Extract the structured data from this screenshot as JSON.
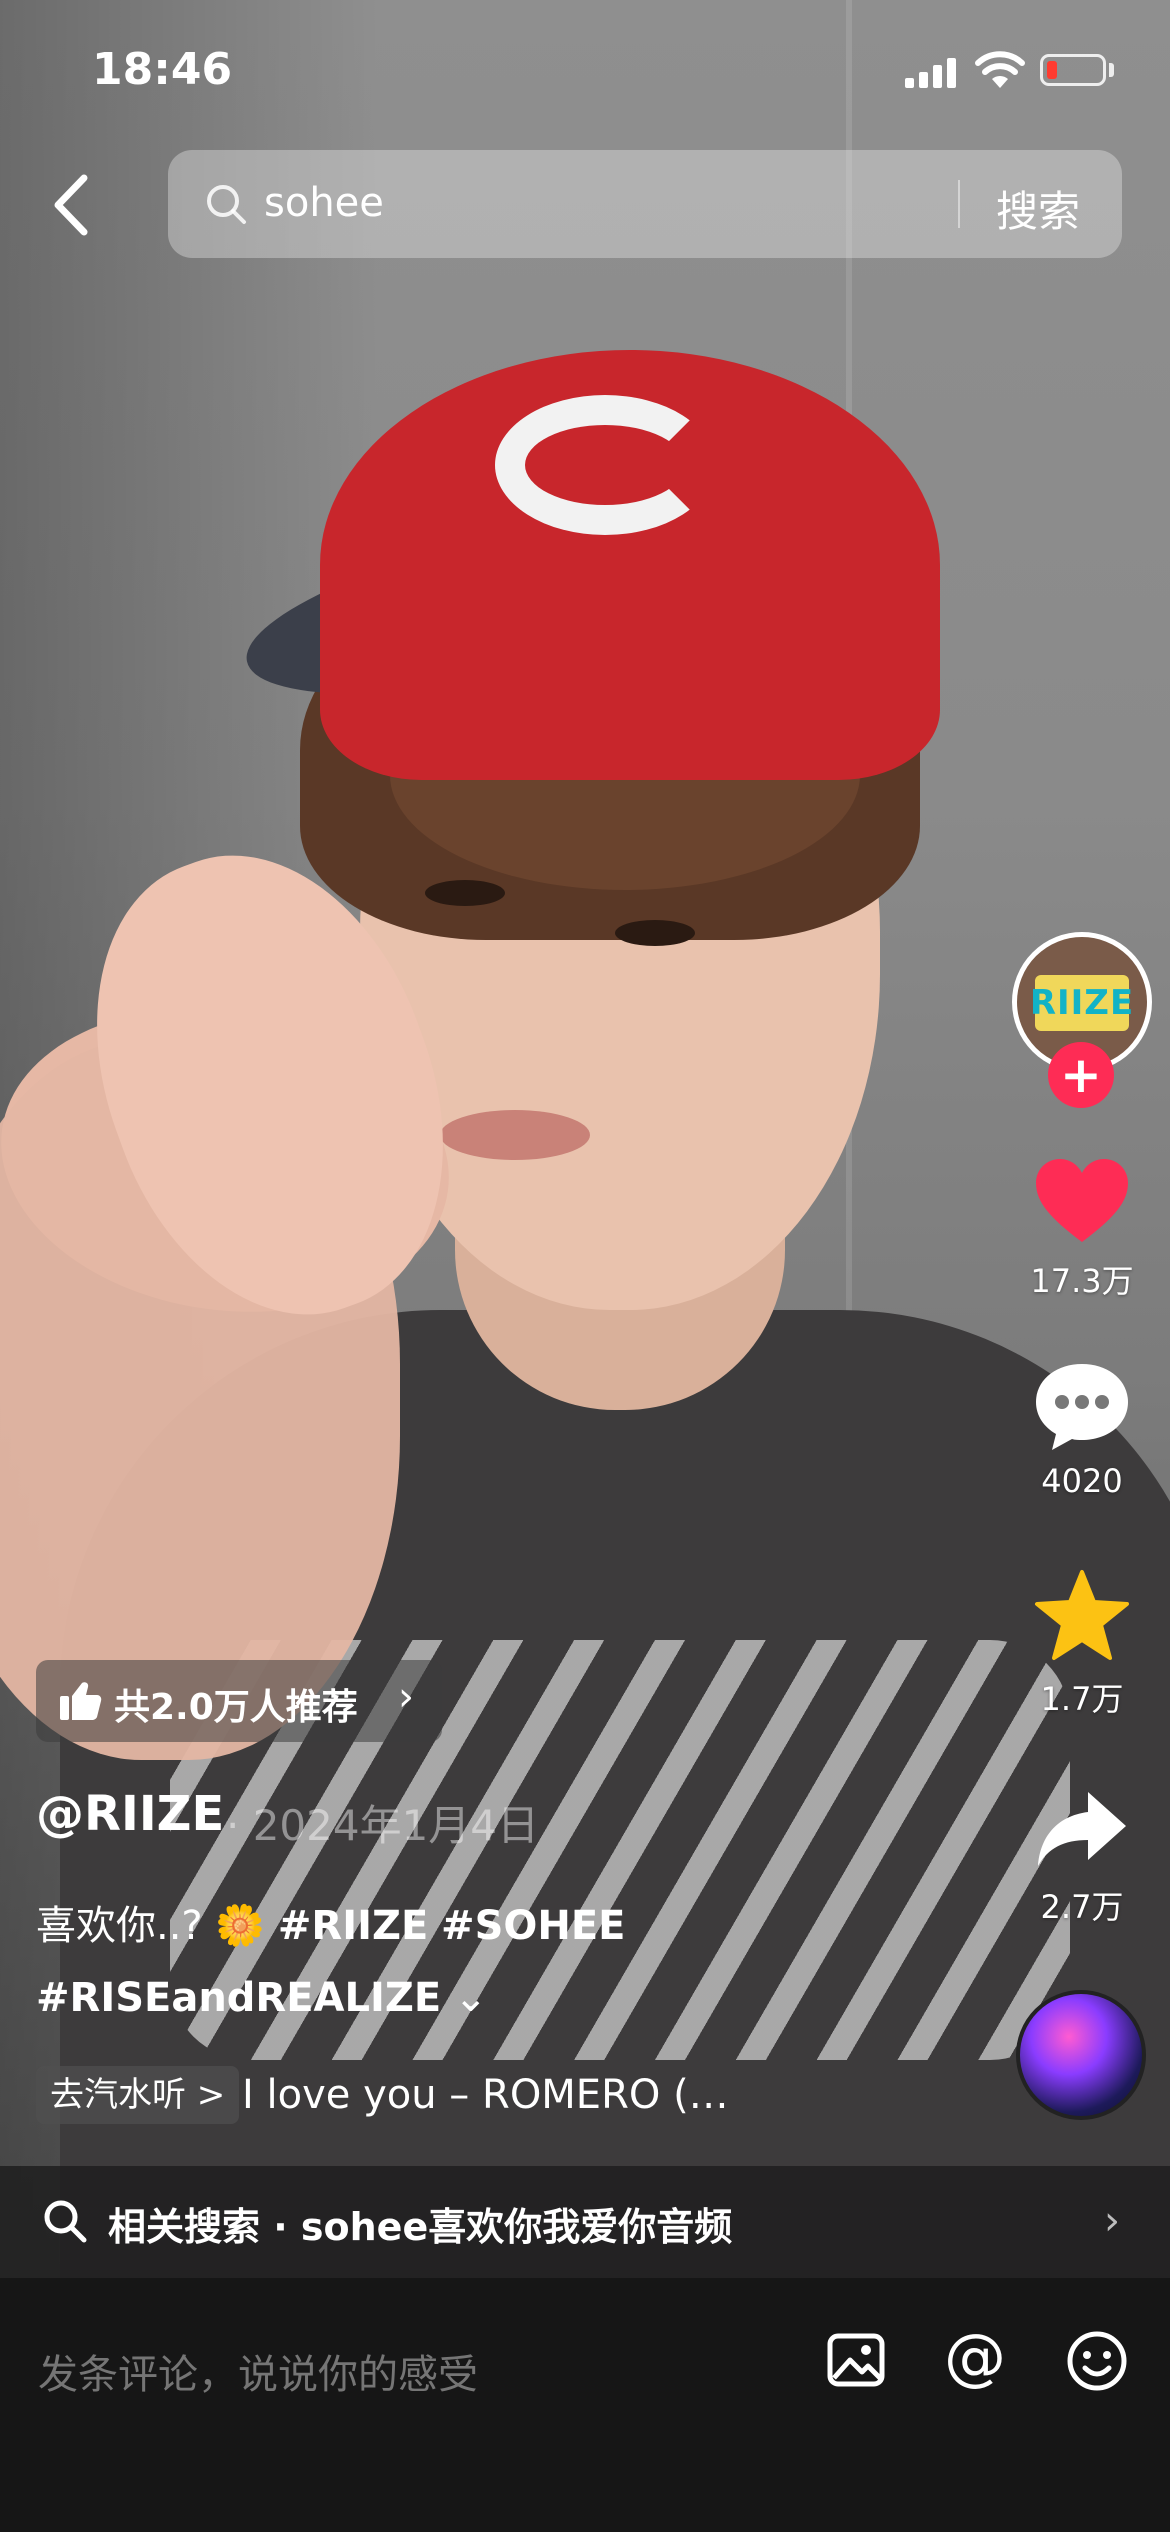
{
  "status_bar": {
    "time": "18:46"
  },
  "search": {
    "query": "sohee",
    "button_label": "搜索"
  },
  "rail": {
    "like_count": "17.3万",
    "comment_count": "4020",
    "collect_count": "1.7万",
    "share_count": "2.7万",
    "avatar_text": "RIIZE",
    "follow_label": "+"
  },
  "video_info": {
    "recommend_text": "共2.0万人推荐",
    "author": "@RIIZE",
    "date": "· 2024年1月4日",
    "caption_text": "喜欢你..? ",
    "caption_emoji": "🌼",
    "caption_tags": [
      "#RIIZE",
      "#SOHEE",
      "#RISEandREALIZE"
    ],
    "caption_expand": "⌄",
    "music_chip": "去汽水听 >",
    "music_title": "I love you – ROMERO (…"
  },
  "related_search": {
    "text": "相关搜索 · sohee喜欢你我爱你音频"
  },
  "comment_bar": {
    "placeholder": "发条评论，说说你的感受"
  },
  "colors": {
    "accent_red": "#fe2c55",
    "collect_yellow": "#fcc213",
    "cap_red": "#c8262c"
  },
  "icons": [
    "back-icon",
    "search-icon",
    "heart-icon",
    "comment-icon",
    "star-icon",
    "share-icon",
    "thumbs-up-icon",
    "image-icon",
    "at-icon",
    "emoji-icon"
  ]
}
